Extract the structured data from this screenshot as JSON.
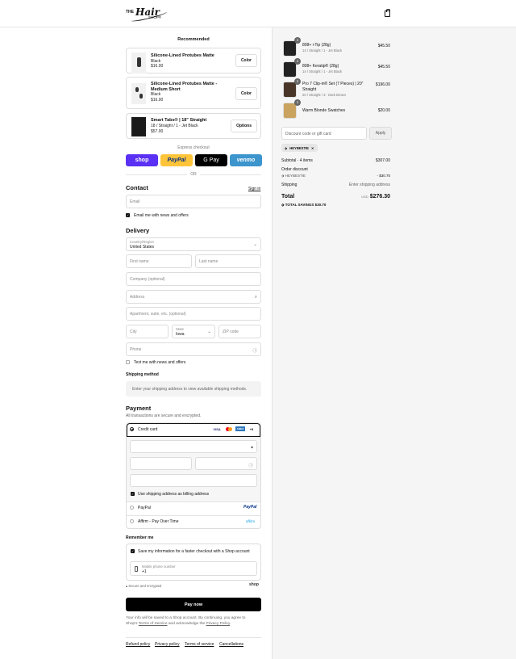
{
  "header": {
    "logo_the": "THE",
    "logo_hair": "Hair",
    "logo_shop": "SHOP®"
  },
  "recommended": {
    "title": "Recommended",
    "items": [
      {
        "name": "Silicone-Lined Protubes Matte",
        "variant": "Black",
        "price": "$16.00",
        "button": "Color"
      },
      {
        "name": "Silicone-Lined Protubes Matte - Medium Short",
        "variant": "Black",
        "price": "$16.00",
        "button": "Color"
      },
      {
        "name": "Smart Tabs® | 18\" Straight",
        "variant": "18 / Straight / 1 - Jet Black",
        "price": "$57.00",
        "button": "Options"
      }
    ]
  },
  "express": {
    "label": "Express checkout",
    "shop": "shop",
    "paypal": "PayPal",
    "gpay": "G Pay",
    "venmo": "venmo",
    "or": "OR"
  },
  "contact": {
    "title": "Contact",
    "sign_in": "Sign in",
    "email_placeholder": "Email",
    "news_label": "Email me with news and offers"
  },
  "delivery": {
    "title": "Delivery",
    "country_label": "Country/Region",
    "country_value": "United States",
    "first_name": "First name",
    "last_name": "Last name",
    "company": "Company (optional)",
    "address": "Address",
    "apartment": "Apartment, suite, etc. (optional)",
    "city": "City",
    "state_label": "State",
    "state_value": "Iowa",
    "zip": "ZIP code",
    "phone": "Phone",
    "text_news": "Text me with news and offers"
  },
  "shipping": {
    "title": "Shipping method",
    "message": "Enter your shipping address to view available shipping methods."
  },
  "payment": {
    "title": "Payment",
    "subtitle": "All transactions are secure and encrypted.",
    "credit_card": "Credit card",
    "brands": [
      "VISA",
      "MC",
      "AMEX",
      "+5"
    ],
    "billing_label": "Use shipping address as billing address",
    "paypal": "PayPal",
    "paypal_logo": "PayPal",
    "affirm": "Affirm - Pay Over Time",
    "affirm_logo": "affirm"
  },
  "remember": {
    "title": "Remember me",
    "save_label": "Save my information for a faster checkout with a Shop account",
    "phone_label": "Mobile phone number",
    "phone_value": "+1",
    "secure": "Secure and encrypted",
    "shop": "shop"
  },
  "pay_now": "Pay now",
  "legal": {
    "line1": "Your info will be saved to a Shop account. By continuing, you agree to",
    "pre": "Shop's",
    "terms": "Terms of Service",
    "mid": "and acknowledge the",
    "privacy": "Privacy Policy"
  },
  "policies": [
    "Refund policy",
    "Privacy policy",
    "Terms of service",
    "Cancellations"
  ],
  "order": {
    "items": [
      {
        "qty": "1",
        "name": "808+ i-Tip (28g)",
        "variant": "14 / Straight / 1 - Jet Black",
        "price": "$45.50"
      },
      {
        "qty": "1",
        "name": "808+ Keratip® (28g)",
        "variant": "14 / Straight / 1 - Jet Black",
        "price": "$45.50"
      },
      {
        "qty": "1",
        "name": "Pro 7 Clip-in® Set (7 Pieces) | 20\" Straight",
        "variant": "20 / Straight / 3 - Dark Brown",
        "price": "$196.00"
      },
      {
        "qty": "1",
        "name": "Warm Blonde Swatches",
        "variant": "",
        "price": "$20.00"
      }
    ],
    "discount_placeholder": "Discount code or gift card",
    "apply": "Apply",
    "code_tag": "HEYBESTIE",
    "subtotal_label": "Subtotal · 4 items",
    "subtotal_value": "$307.00",
    "order_discount": "Order discount",
    "discount_code": "HEYBESTIE",
    "discount_value": "- $30.70",
    "shipping_label": "Shipping",
    "shipping_value": "Enter shipping address",
    "total_label": "Total",
    "currency": "USD",
    "total_value": "$276.30",
    "savings_label": "TOTAL SAVINGS",
    "savings_value": "$30.70"
  }
}
